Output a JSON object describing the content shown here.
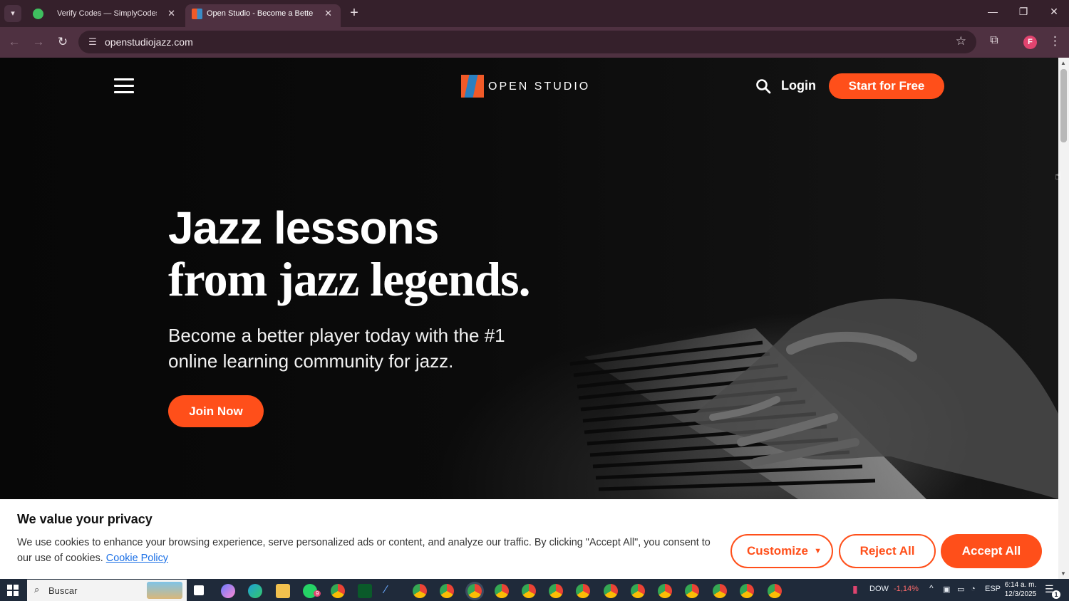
{
  "browser": {
    "tabs": [
      {
        "title": "Verify Codes — SimplyCodes",
        "active": false
      },
      {
        "title": "Open Studio - Become a Better Player",
        "active": true
      }
    ],
    "address": "openstudiojazz.com",
    "profile_initial": "F",
    "icons": {
      "tab_list": "chevron-down-icon",
      "new_tab": "plus-icon",
      "back": "arrow-left-icon",
      "forward": "arrow-right-icon",
      "reload": "reload-icon",
      "site_info": "tune-icon",
      "bookmark": "star-icon",
      "extensions": "puzzle-icon",
      "menu": "kebab-icon"
    }
  },
  "site": {
    "logo_text": "OPEN STUDIO",
    "login": "Login",
    "cta": "Start for Free",
    "headline_line1": "Jazz lessons",
    "headline_line2": "from jazz legends.",
    "subhead": "Become a better player today with the #1 online learning community for jazz.",
    "join": "Join Now",
    "accent_color": "#ff4f1a"
  },
  "cookie": {
    "title": "We value your privacy",
    "text": "We use cookies to enhance your browsing experience, serve personalized ads or content, and analyze our traffic. By clicking \"Accept All\", you consent to our use of cookies.",
    "link": "Cookie Policy",
    "customize": "Customize",
    "reject": "Reject All",
    "accept": "Accept All"
  },
  "taskbar": {
    "search_placeholder": "Buscar",
    "whatsapp_badge": "9",
    "ticker_name": "DOW",
    "ticker_change": "-1,14%",
    "language": "ESP",
    "time": "6:14 a. m.",
    "date": "12/3/2025",
    "notification_count": "1"
  }
}
